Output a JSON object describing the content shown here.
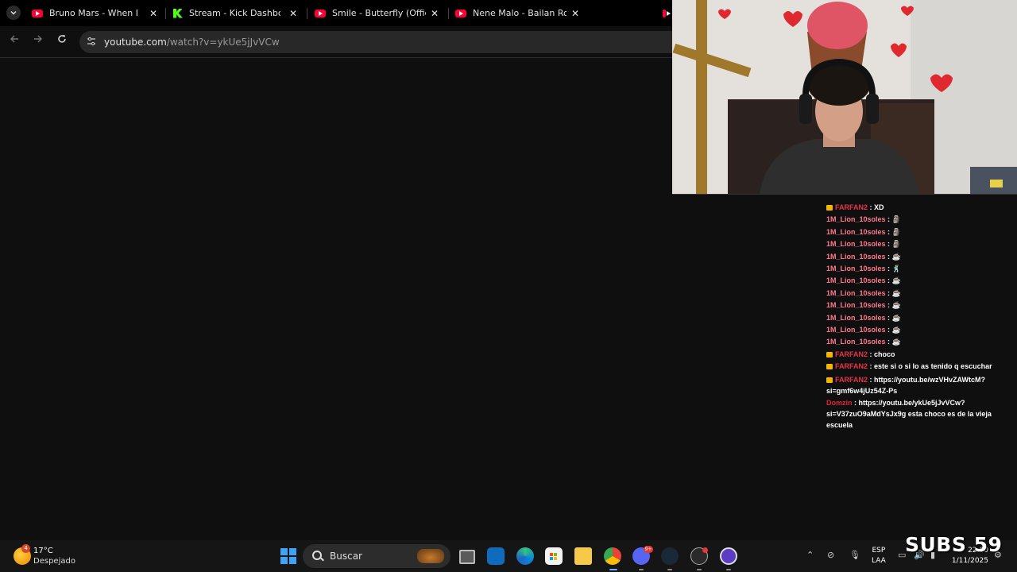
{
  "browser": {
    "tabs": [
      {
        "title": "Bruno Mars - When I Was",
        "favicon": "youtube-icon"
      },
      {
        "title": "Stream - Kick Dashboard",
        "favicon": "kick-icon"
      },
      {
        "title": "Smile - Butterfly (Official M",
        "favicon": "youtube-icon"
      },
      {
        "title": "Nene Malo - Bailan Rochas",
        "favicon": "youtube-icon"
      }
    ],
    "url_host": "youtube.com",
    "url_rest": "/watch?v=ykUe5jJvVCw"
  },
  "chat": {
    "messages": [
      {
        "user": "FARFAN2",
        "text": ": XD",
        "badge": true
      },
      {
        "user": "1M_Lion_10soles",
        "text": ": 🗿"
      },
      {
        "user": "1M_Lion_10soles",
        "text": ": 🗿"
      },
      {
        "user": "1M_Lion_10soles",
        "text": ": 🗿"
      },
      {
        "user": "1M_Lion_10soles",
        "text": ": ☕"
      },
      {
        "user": "1M_Lion_10soles",
        "text": ": 🕺"
      },
      {
        "user": "1M_Lion_10soles",
        "text": ": ☕"
      },
      {
        "user": "1M_Lion_10soles",
        "text": ": ☕"
      },
      {
        "user": "1M_Lion_10soles",
        "text": ": ☕"
      },
      {
        "user": "1M_Lion_10soles",
        "text": ": ☕"
      },
      {
        "user": "1M_Lion_10soles",
        "text": ": ☕"
      },
      {
        "user": "1M_Lion_10soles",
        "text": ": ☕"
      },
      {
        "user": "FARFAN2",
        "text": ": choco",
        "badge": true
      },
      {
        "user": "FARFAN2",
        "text": ": este si o si lo as tenido q escuchar",
        "badge": true
      },
      {
        "user": "FARFAN2",
        "text": ": https://youtu.be/wzVHvZAWtcM?si=gmf6w4jUz54Z-Ps",
        "badge": true
      },
      {
        "user": "Domzin",
        "text": ": https://youtu.be/ykUe5jJvVCw?si=V37zuO9aMdYsJx9g esta choco es de la vieja escuela"
      }
    ]
  },
  "taskbar": {
    "weather_badge": "4",
    "temperature": "17°C",
    "condition": "Despejado",
    "search_label": "Buscar",
    "discord_badge": "9+",
    "language_line1": "ESP",
    "language_line2": "LAA",
    "time": "22:00",
    "date": "1/11/2025"
  },
  "overlay": {
    "subs_text": "SUBS 59"
  },
  "colors": {
    "kick_green": "#53fc18",
    "youtube_red": "#ff0033",
    "chat_user_red": "#e8334a",
    "chat_user_pink": "#ff7a8c"
  }
}
